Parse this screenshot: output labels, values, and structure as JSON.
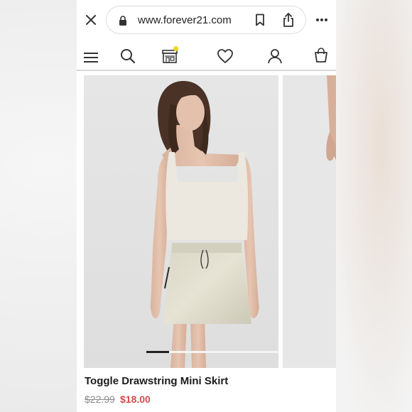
{
  "browser": {
    "url": "www.forever21.com",
    "icons": [
      "close-icon",
      "lock-icon",
      "bookmark-icon",
      "share-icon",
      "more-icon"
    ]
  },
  "nav": {
    "icons": [
      "menu-icon",
      "search-icon",
      "store-icon",
      "wishlist-icon",
      "account-icon",
      "bag-icon"
    ],
    "badge_color": "#f2d51a"
  },
  "product": {
    "title": "Toggle Drawstring Mini Skirt",
    "original_price": "$22.99",
    "sale_price": "$18.00",
    "sale_color": "#d64a4a",
    "carousel": {
      "current_slide": 1
    }
  }
}
